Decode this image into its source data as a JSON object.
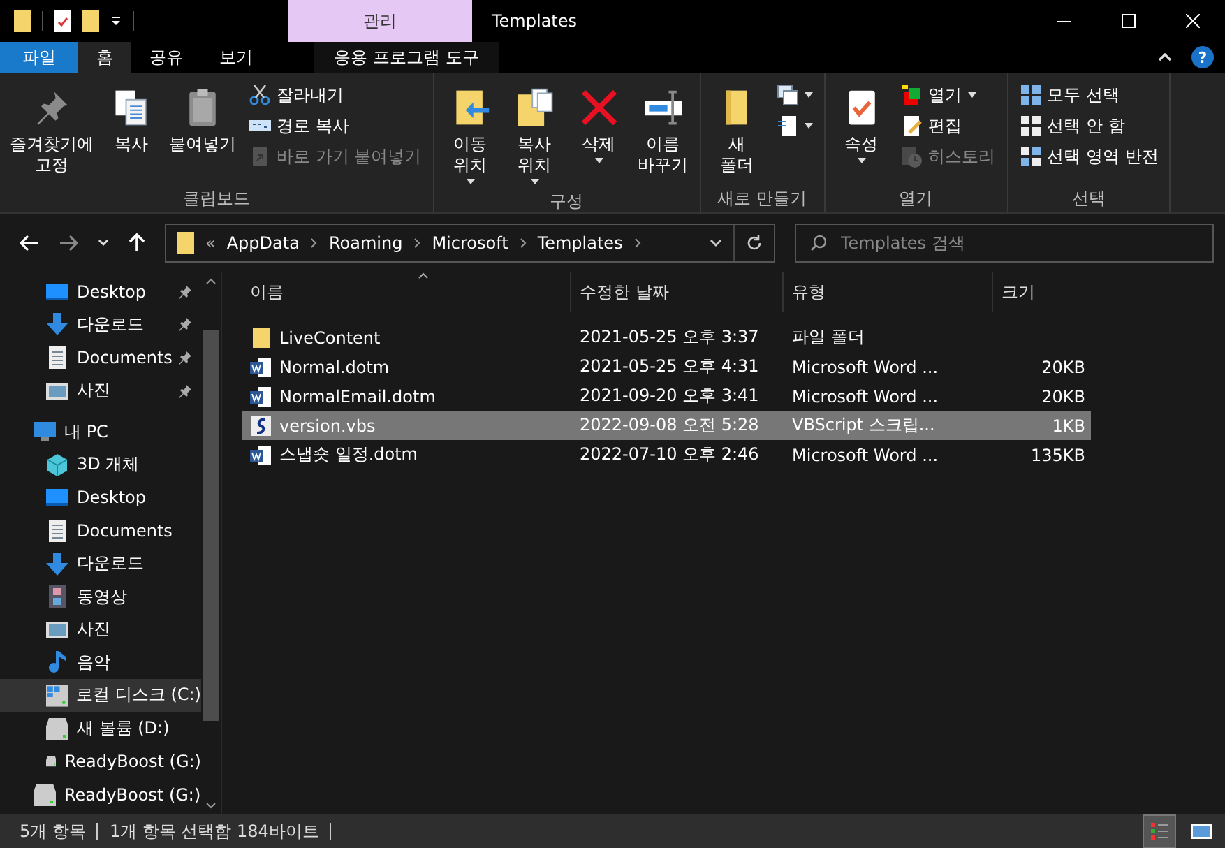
{
  "window": {
    "title": "Templates",
    "context_tab": "관리"
  },
  "tabs": [
    {
      "label": "파일",
      "kind": "file",
      "selected": false
    },
    {
      "label": "홈",
      "kind": "tab",
      "selected": true
    },
    {
      "label": "공유",
      "kind": "tab",
      "selected": false
    },
    {
      "label": "보기",
      "kind": "tab",
      "selected": false
    },
    {
      "label": "응용 프로그램 도구",
      "kind": "context",
      "selected": false
    }
  ],
  "help_glyph": "?",
  "ribbon": {
    "groups": [
      {
        "label": "클립보드",
        "items": [
          {
            "kind": "large",
            "label": "즐겨찾기에\n고정",
            "disabled": false,
            "dropdown": false
          },
          {
            "kind": "large",
            "label": "복사",
            "disabled": false,
            "dropdown": false
          },
          {
            "kind": "large",
            "label": "붙여넣기",
            "disabled": false,
            "dropdown": false
          },
          {
            "kind": "stack",
            "items": [
              {
                "label": "잘라내기",
                "disabled": false,
                "dropdown": false
              },
              {
                "label": "경로 복사",
                "disabled": false,
                "dropdown": false
              },
              {
                "label": "바로 가기 붙여넣기",
                "disabled": true,
                "dropdown": false
              }
            ]
          }
        ]
      },
      {
        "label": "구성",
        "items": [
          {
            "kind": "large",
            "label": "이동\n위치",
            "disabled": false,
            "dropdown": true
          },
          {
            "kind": "large",
            "label": "복사\n위치",
            "disabled": false,
            "dropdown": true
          },
          {
            "kind": "large",
            "label": "삭제",
            "disabled": false,
            "dropdown": true
          },
          {
            "kind": "large",
            "label": "이름\n바꾸기",
            "disabled": false,
            "dropdown": false
          }
        ]
      },
      {
        "label": "새로 만들기",
        "items": [
          {
            "kind": "large",
            "label": "새\n폴더",
            "disabled": false,
            "dropdown": false
          },
          {
            "kind": "stack",
            "items": [
              {
                "disabled": false,
                "dropdown": true
              },
              {
                "disabled": false,
                "dropdown": true
              }
            ]
          }
        ]
      },
      {
        "label": "열기",
        "items": [
          {
            "kind": "large",
            "label": "속성",
            "disabled": false,
            "dropdown": true
          },
          {
            "kind": "stack",
            "items": [
              {
                "label": "열기",
                "disabled": false,
                "dropdown": true
              },
              {
                "label": "편집",
                "disabled": false,
                "dropdown": false
              },
              {
                "label": "히스토리",
                "disabled": true,
                "dropdown": false
              }
            ]
          }
        ]
      },
      {
        "label": "선택",
        "items": [
          {
            "kind": "stack",
            "items": [
              {
                "label": "모두 선택",
                "disabled": false,
                "dropdown": false
              },
              {
                "label": "선택 안 함",
                "disabled": false,
                "dropdown": false
              },
              {
                "label": "선택 영역 반전",
                "disabled": false,
                "dropdown": false
              }
            ]
          }
        ]
      }
    ]
  },
  "address": {
    "overflow": "«",
    "segments": [
      "AppData",
      "Roaming",
      "Microsoft",
      "Templates"
    ],
    "search_placeholder": "Templates 검색"
  },
  "navigation": {
    "quick_access": [
      {
        "label": "Desktop",
        "pinned": true
      },
      {
        "label": "다운로드",
        "pinned": true
      },
      {
        "label": "Documents",
        "pinned": true
      },
      {
        "label": "사진",
        "pinned": true
      }
    ],
    "tree": [
      {
        "label": "내 PC",
        "selected": false,
        "children": [
          {
            "label": "3D 개체",
            "selected": false
          },
          {
            "label": "Desktop",
            "selected": false
          },
          {
            "label": "Documents",
            "selected": false
          },
          {
            "label": "다운로드",
            "selected": false
          },
          {
            "label": "동영상",
            "selected": false
          },
          {
            "label": "사진",
            "selected": false
          },
          {
            "label": "음악",
            "selected": false
          },
          {
            "label": "로컬 디스크 (C:)",
            "selected": true
          },
          {
            "label": "새 볼륨 (D:)",
            "selected": false
          },
          {
            "label": "ReadyBoost (G:)",
            "selected": false
          }
        ]
      },
      {
        "label": "ReadyBoost (G:)",
        "selected": false
      }
    ]
  },
  "table": {
    "columns": [
      "이름",
      "수정한 날짜",
      "유형",
      "크기"
    ],
    "rows": [
      {
        "name": "LiveContent",
        "date": "2021-05-25 오후 3:37",
        "type": "파일 폴더",
        "selected": false
      },
      {
        "name": "Normal.dotm",
        "date": "2021-05-25 오후 4:31",
        "type": "Microsoft Word ...",
        "size": "20KB",
        "selected": false
      },
      {
        "name": "NormalEmail.dotm",
        "date": "2021-09-20 오후 3:41",
        "type": "Microsoft Word ...",
        "size": "20KB",
        "selected": false
      },
      {
        "name": "version.vbs",
        "date": "2022-09-08 오전 5:28",
        "type": "VBScript 스크립...",
        "size": "1KB",
        "selected": true
      },
      {
        "name": "스냅숏 일정.dotm",
        "date": "2022-07-10 오후 2:46",
        "type": "Microsoft Word ...",
        "size": "135KB",
        "selected": false
      }
    ]
  },
  "status_bar": {
    "item_count": "5개 항목",
    "selection": "1개 항목 선택함 184바이트",
    "views": [
      {
        "kind": "details",
        "selected": true
      },
      {
        "kind": "large-icons",
        "selected": false
      }
    ]
  }
}
